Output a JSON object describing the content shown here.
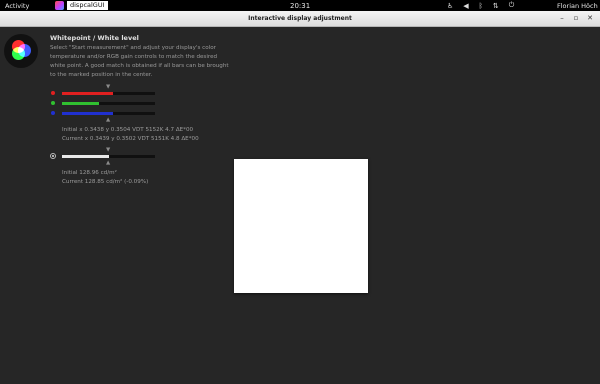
{
  "topbar": {
    "activities": "Activity",
    "app_name": "dispcalGUI",
    "clock": "20:31",
    "user": "Florian Höch",
    "tray_icons": [
      "accessibility-icon",
      "volume-icon",
      "bluetooth-icon",
      "network-icon",
      "power-icon"
    ]
  },
  "window": {
    "title": "Interactive display adjustment"
  },
  "panel": {
    "heading": "Whitepoint / White level",
    "description": "Select \"Start measurement\" and adjust your display's color temperature and/or RGB gain controls to match the desired white point. A good match is obtained if all bars can be brought to the marked position in the center."
  },
  "sliders": {
    "red": {
      "color": "#e02020",
      "level": 0.55
    },
    "green": {
      "color": "#30c030",
      "level": 0.4
    },
    "blue": {
      "color": "#2030d0",
      "level": 0.55
    },
    "marker_glyph_down": "▼",
    "marker_glyph_up": "▲"
  },
  "measurements": {
    "whitepoint_initial": "Initial x 0.3438 y 0.3504 VDT 5152K 4.7 ΔE*00",
    "whitepoint_current": "Current x 0.3439 y 0.3502 VDT 5151K 4.8 ΔE*00",
    "luminance_initial": "Initial 128.96 cd/m²",
    "luminance_current": "Current 128.85 cd/m² (-0.09%)"
  },
  "luminance_slider": {
    "color": "#e8e8e8",
    "level": 0.5
  },
  "measurement_patch": {
    "color": "#ffffff"
  }
}
